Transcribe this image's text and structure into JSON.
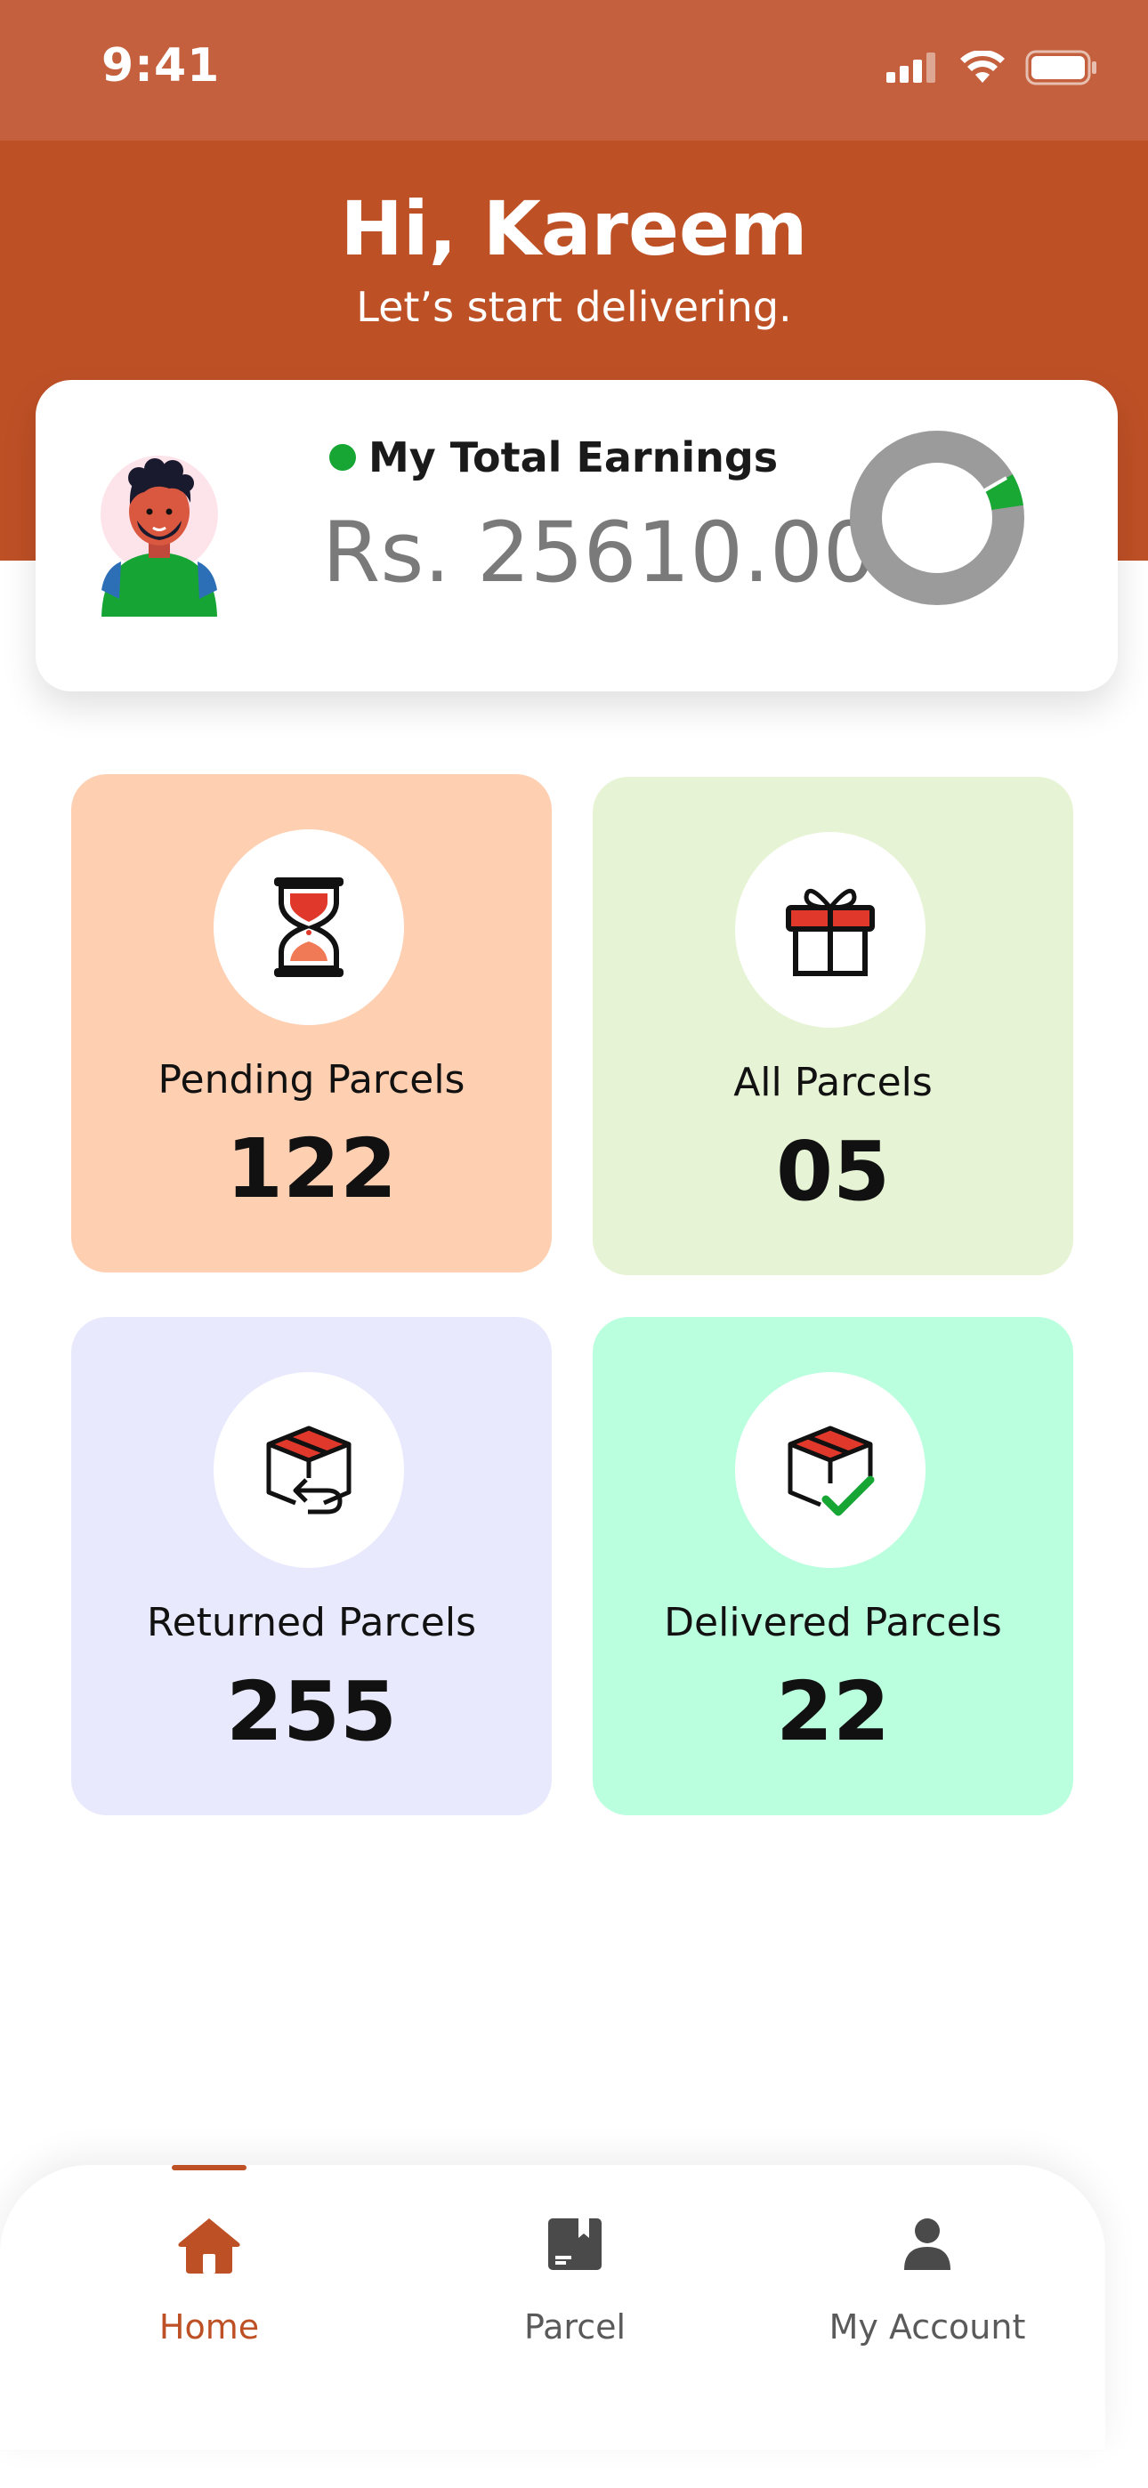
{
  "status_bar": {
    "time": "9:41"
  },
  "header": {
    "greeting": "Hi, Kareem",
    "subtitle": "Let’s start delivering."
  },
  "earnings": {
    "title": "My Total Earnings",
    "amount": "Rs. 25610.00",
    "ring_progress": 0.06
  },
  "tiles": [
    {
      "label": "Pending Parcels",
      "count": "122",
      "icon": "hourglass-icon"
    },
    {
      "label": "All Parcels",
      "count": "05",
      "icon": "gift-icon"
    },
    {
      "label": "Returned Parcels",
      "count": "255",
      "icon": "box-return-icon"
    },
    {
      "label": "Delivered Parcels",
      "count": "22",
      "icon": "box-check-icon"
    }
  ],
  "nav": {
    "items": [
      {
        "label": "Home",
        "icon": "home-icon",
        "active": true
      },
      {
        "label": "Parcel",
        "icon": "parcel-icon",
        "active": false
      },
      {
        "label": "My Account",
        "icon": "account-icon",
        "active": false
      }
    ]
  },
  "colors": {
    "primary": "#be5026",
    "status_bar": "#c4603d",
    "online": "#17a534"
  }
}
